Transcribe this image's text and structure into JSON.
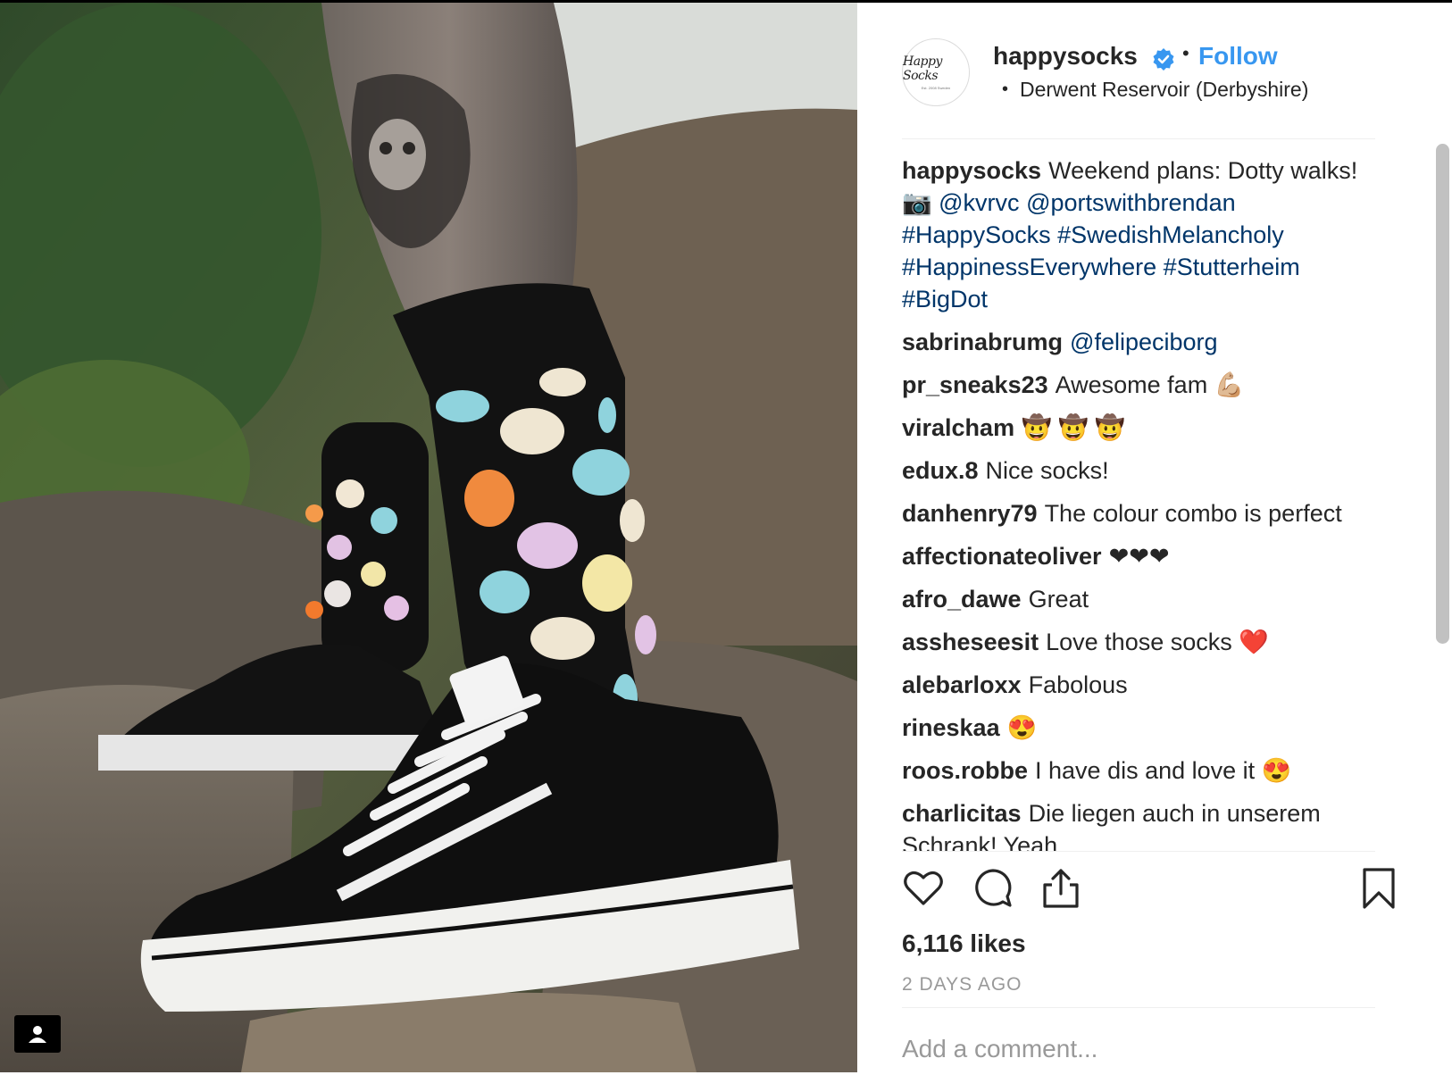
{
  "post": {
    "username": "happysocks",
    "verified_icon": "verified-badge-icon",
    "separator": "•",
    "follow_label": "Follow",
    "location_bullet": "•",
    "location": "Derwent Reservoir (Derbyshire)",
    "avatar_text": "Happy Socks",
    "avatar_subtext": "Est. 2008 Sweden"
  },
  "caption": {
    "username": "happysocks",
    "text": "Weekend plans: Dotty walks!",
    "camera_icon": "📷",
    "mentions": [
      "@kvrvc",
      "@portswithbrendan"
    ],
    "hashtags": [
      "#HappySocks",
      "#SwedishMelancholy",
      "#HappinessEverywhere",
      "#Stutterheim",
      "#BigDot"
    ]
  },
  "comments": [
    {
      "user": "sabrinabrumg",
      "text": "",
      "mention": "@felipeciborg"
    },
    {
      "user": "pr_sneaks23",
      "text": "Awesome fam 💪🏼"
    },
    {
      "user": "viralcham",
      "text": "🤠 🤠 🤠"
    },
    {
      "user": "edux.8",
      "text": "Nice socks!"
    },
    {
      "user": "danhenry79",
      "text": "The colour combo is perfect"
    },
    {
      "user": "affectionateoliver",
      "text": "❤❤❤"
    },
    {
      "user": "afro_dawe",
      "text": "Great"
    },
    {
      "user": "assheseesit",
      "text": "Love those socks ❤️"
    },
    {
      "user": "alebarloxx",
      "text": "Fabolous"
    },
    {
      "user": "rineskaa",
      "text": "😍"
    },
    {
      "user": "roos.robbe",
      "text": "I have dis and love it 😍"
    },
    {
      "user": "charlicitas",
      "text": "Die liegen auch in unserem Schrank! Yeah"
    }
  ],
  "actions": {
    "like_icon": "heart-icon",
    "comment_icon": "comment-bubble-icon",
    "share_icon": "share-icon",
    "save_icon": "bookmark-icon"
  },
  "likes": "6,116 likes",
  "date": "2 DAYS AGO",
  "comment_input": {
    "placeholder": "Add a comment..."
  },
  "photo": {
    "tag_icon": "user-tag-icon"
  },
  "colors": {
    "link": "#003569",
    "follow": "#3897f0",
    "muted": "#999999",
    "divider": "#efefef"
  }
}
